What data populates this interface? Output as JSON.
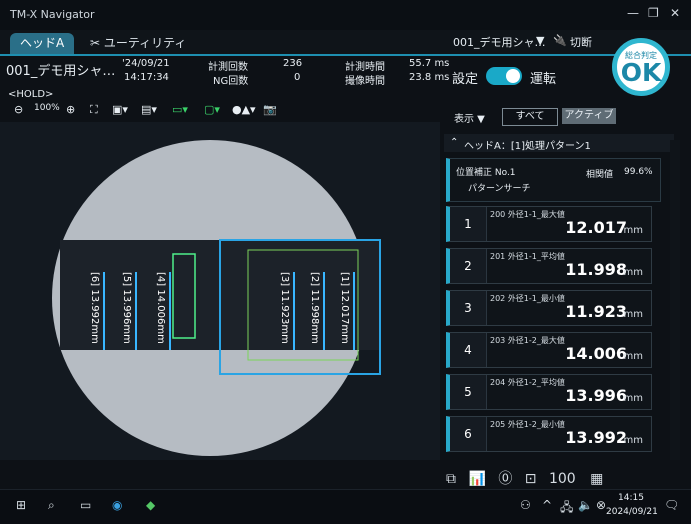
{
  "app": {
    "title": "TM-X Navigator"
  },
  "tabs": [
    {
      "label": "ヘッドA"
    },
    {
      "label": "ユーティリティ"
    }
  ],
  "header": {
    "program": "001_デモ用シャ…",
    "menu_label": "切断",
    "date": "'24/09/21",
    "time": "14:17:34",
    "measure_count_label": "計測回数",
    "measure_count": "236",
    "ng_count_label": "NG回数",
    "ng_count": "0",
    "measure_time_label": "計測時間",
    "measure_time": "55.7 ms",
    "capture_time_label": "撮像時間",
    "capture_time": "23.8 ms",
    "setting_label": "設定",
    "run_label": "運転",
    "overall_label": "総合判定",
    "overall_value": "OK"
  },
  "left_toolbar": {
    "hold": "<HOLD>",
    "zoom": "100%"
  },
  "view": {
    "display_label": "表示",
    "all_label": "すべて",
    "active_label": "アクティブ",
    "section_title": "ヘッドA：[1]処理パターン1",
    "pos_title": "位置補正 No.1",
    "pos_sub": "パターンサーチ",
    "corr_label": "相関値",
    "corr_value": "99.6%"
  },
  "measurements": [
    {
      "idx": "1",
      "name": "200 外径1-1_最大値",
      "value": "12.017",
      "unit": "mm"
    },
    {
      "idx": "2",
      "name": "201 外径1-1_平均値",
      "value": "11.998",
      "unit": "mm"
    },
    {
      "idx": "3",
      "name": "202 外径1-1_最小値",
      "value": "11.923",
      "unit": "mm"
    },
    {
      "idx": "4",
      "name": "203 外径1-2_最大値",
      "value": "14.006",
      "unit": "mm"
    },
    {
      "idx": "5",
      "name": "204 外径1-2_平均値",
      "value": "13.996",
      "unit": "mm"
    },
    {
      "idx": "6",
      "name": "205 外径1-2_最小値",
      "value": "13.992",
      "unit": "mm"
    }
  ],
  "overlay_labels": [
    {
      "text": "[6] 13.992mm"
    },
    {
      "text": "[5] 13.996mm"
    },
    {
      "text": "[4] 14.006mm"
    },
    {
      "text": "[3] 11.923mm"
    },
    {
      "text": "[2] 11.998mm"
    },
    {
      "text": "[1] 12.017mm"
    }
  ],
  "taskbar": {
    "clock_time": "14:15",
    "clock_date": "2024/09/21",
    "notif": "1"
  }
}
